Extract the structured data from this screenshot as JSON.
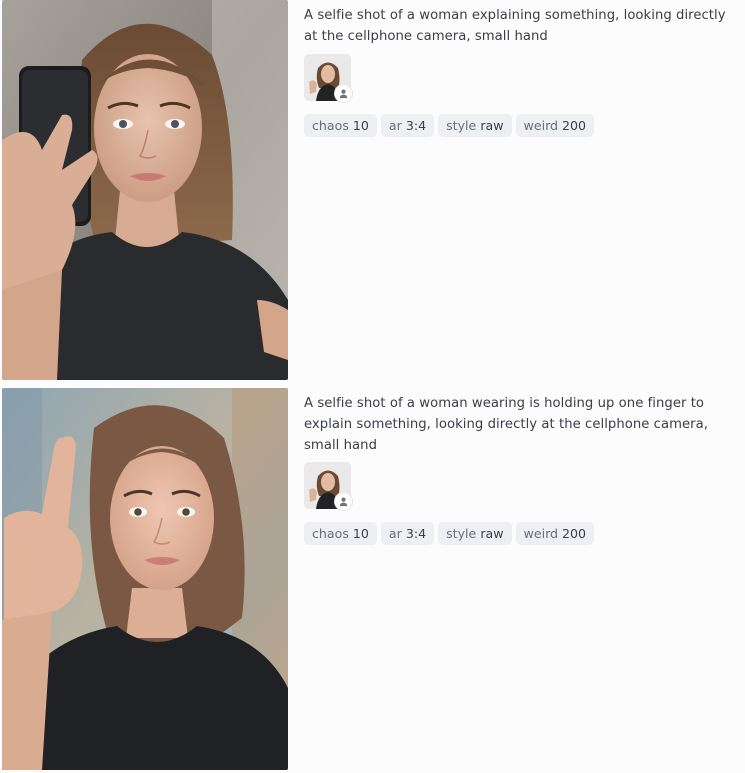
{
  "results": [
    {
      "prompt": "A selfie shot of a woman explaining something, looking directly at the cellphone camera, small hand",
      "image": "selfie-woman-holding-phone",
      "reference_image": "woman-portrait-reference",
      "params": [
        {
          "key": "chaos",
          "value": "10"
        },
        {
          "key": "ar",
          "value": "3:4"
        },
        {
          "key": "style",
          "value": "raw"
        },
        {
          "key": "weird",
          "value": "200"
        }
      ]
    },
    {
      "prompt": "A selfie shot of a woman wearing is holding up one finger to explain something, looking directly at the cellphone camera, small hand",
      "image": "selfie-woman-raising-finger",
      "reference_image": "woman-portrait-reference",
      "params": [
        {
          "key": "chaos",
          "value": "10"
        },
        {
          "key": "ar",
          "value": "3:4"
        },
        {
          "key": "style",
          "value": "raw"
        },
        {
          "key": "weird",
          "value": "200"
        }
      ]
    }
  ],
  "colors": {
    "chip_bg": "#eeeff2",
    "page_bg": "#fcfcfd",
    "text": "#3b3e45"
  }
}
